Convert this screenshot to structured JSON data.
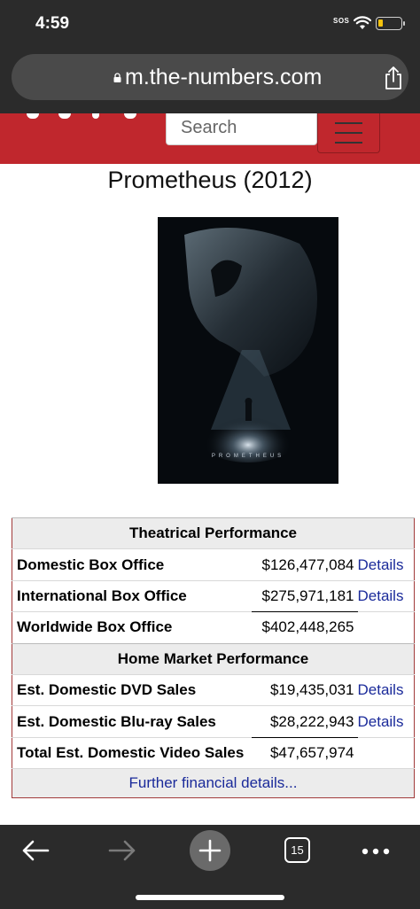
{
  "status_bar": {
    "time": "4:59",
    "sos": "SOS",
    "battery_level": 0.2,
    "battery_color": "#f4c20d"
  },
  "browser": {
    "url": "m.the-numbers.com",
    "lock_icon": "lock-icon",
    "share_icon": "share-icon"
  },
  "site_header": {
    "background_color": "#c0272d",
    "search_placeholder": "Search",
    "social_icons": [
      "facebook-icon",
      "twitter-icon",
      "tiktok-icon",
      "instagram-icon"
    ],
    "menu_icon": "hamburger-menu-icon"
  },
  "movie": {
    "title": "Prometheus (2012)",
    "poster_text": "PROMETHEUS"
  },
  "financials": {
    "theatrical": {
      "heading": "Theatrical Performance",
      "rows": [
        {
          "label": "Domestic Box Office",
          "value": "$126,477,084",
          "link": "Details"
        },
        {
          "label": "International Box Office",
          "value": "$275,971,181",
          "link": "Details"
        },
        {
          "label": "Worldwide Box Office",
          "value": "$402,448,265",
          "link": ""
        }
      ]
    },
    "home_market": {
      "heading": "Home Market Performance",
      "rows": [
        {
          "label": "Est. Domestic DVD Sales",
          "value": "$19,435,031",
          "link": "Details"
        },
        {
          "label": "Est. Domestic Blu-ray Sales",
          "value": "$28,222,943",
          "link": "Details"
        },
        {
          "label": "Total Est. Domestic Video Sales",
          "value": "$47,657,974",
          "link": ""
        }
      ]
    },
    "further_link": "Further financial details..."
  },
  "toolbar": {
    "tab_count": "15",
    "icons": [
      "back-arrow-icon",
      "forward-arrow-icon",
      "plus-icon",
      "tabs-icon",
      "more-dots-icon"
    ]
  }
}
